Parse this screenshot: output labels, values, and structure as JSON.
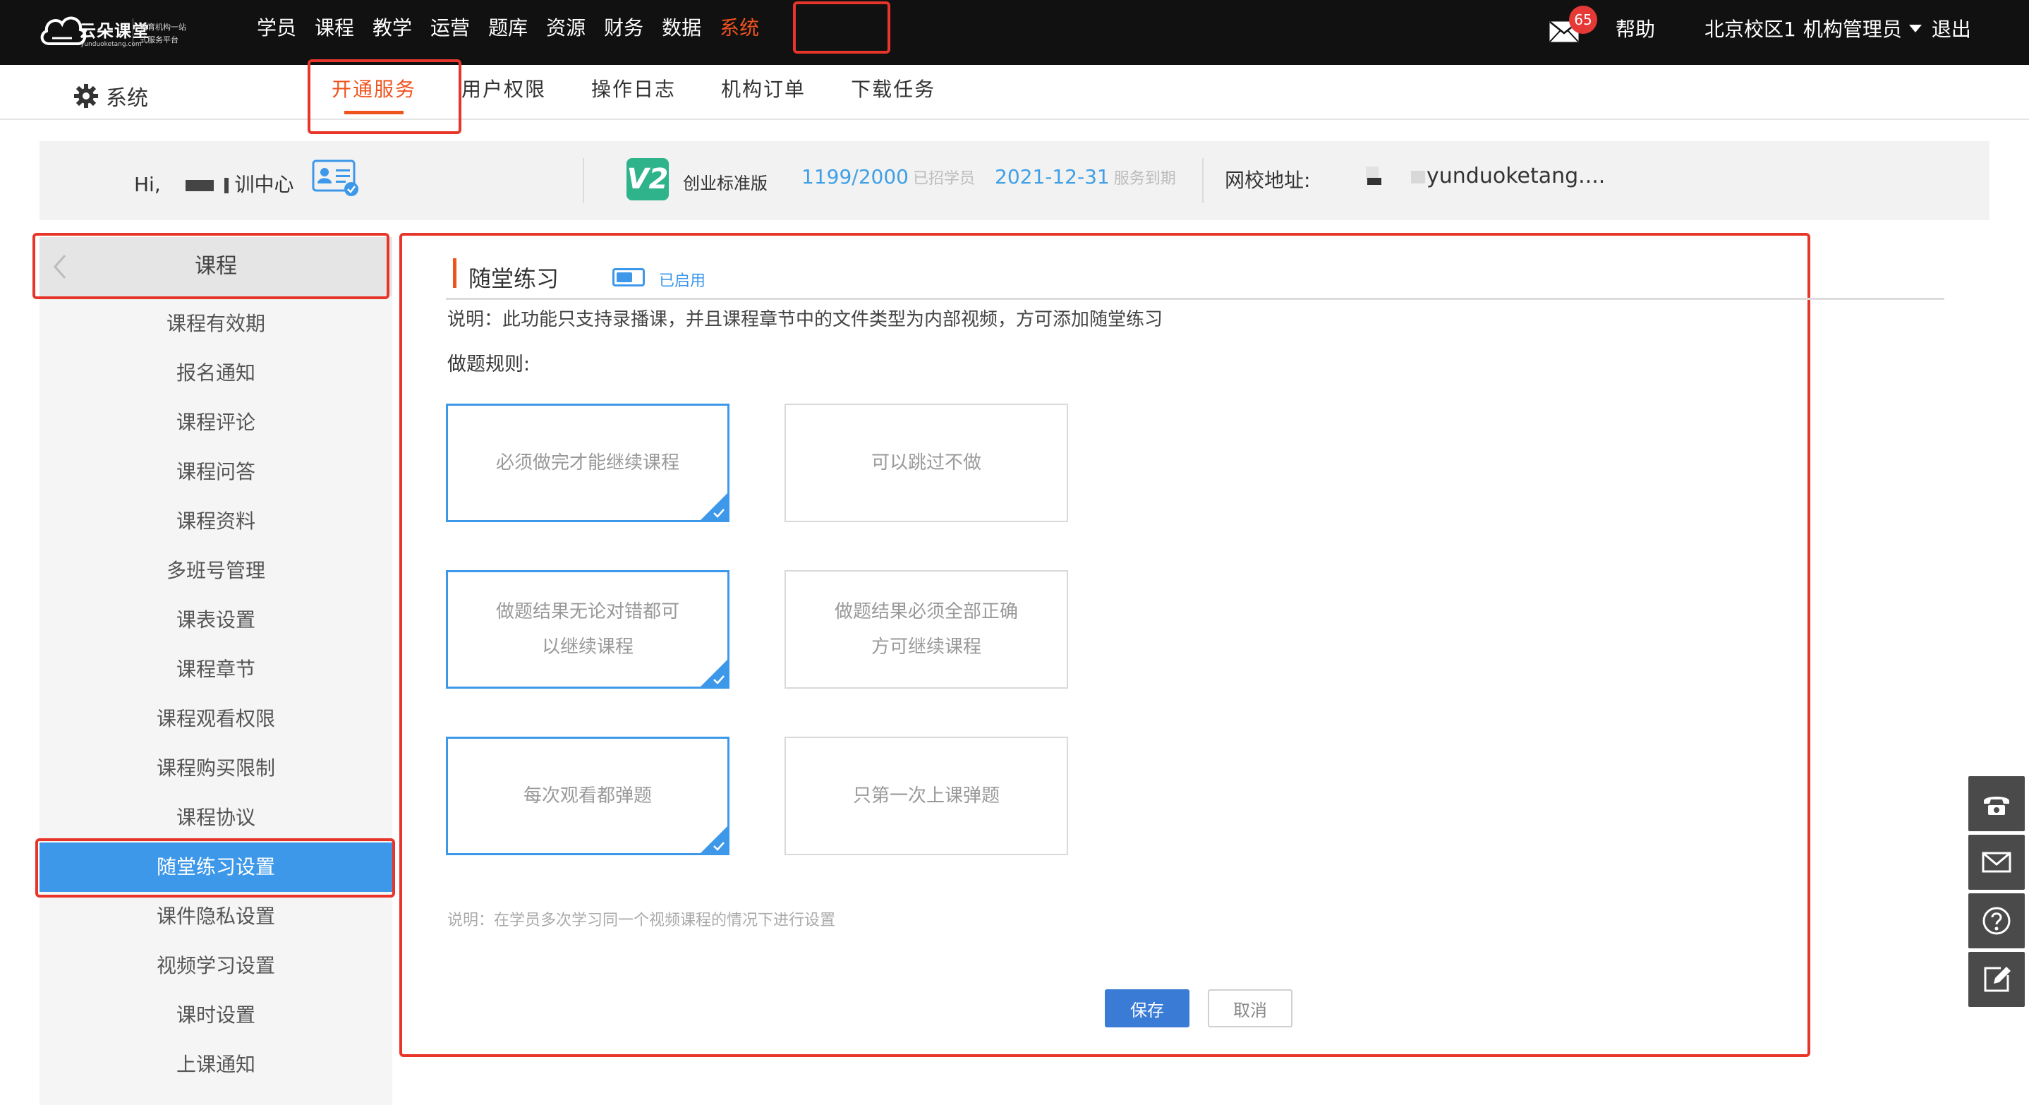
{
  "logo": {
    "name": "云朵课堂",
    "url_text": "yunduoketang.com",
    "slogan_line1": "教育机构一站",
    "slogan_line2": "式服务平台"
  },
  "top_menu": {
    "items": [
      "学员",
      "课程",
      "教学",
      "运营",
      "题库",
      "资源",
      "财务",
      "数据",
      "系统"
    ],
    "active": "系统"
  },
  "header_right": {
    "mail_badge": "65",
    "help": "帮助",
    "campus": "北京校区1",
    "role": "机构管理员",
    "logout": "退出"
  },
  "subbar": {
    "title": "系统",
    "tabs": [
      "开通服务",
      "用户权限",
      "操作日志",
      "机构订单",
      "下载任务"
    ],
    "active": "开通服务"
  },
  "infobar": {
    "greeting": "Hi,",
    "org_suffix": "训中心",
    "edition_badge": "V2",
    "edition": "创业标准版",
    "students": "1199/2000",
    "students_label": "已招学员",
    "expire_date": "2021-12-31",
    "expire_label": "服务到期",
    "school_url_label": "网校地址:",
    "school_url": "yunduoketang...."
  },
  "sidebar": {
    "header": "课程",
    "items": [
      "课程有效期",
      "报名通知",
      "课程评论",
      "课程问答",
      "课程资料",
      "多班号管理",
      "课表设置",
      "课程章节",
      "课程观看权限",
      "课程购买限制",
      "课程协议",
      "随堂练习设置",
      "课件隐私设置",
      "视频学习设置",
      "课时设置",
      "上课通知"
    ],
    "active": "随堂练习设置"
  },
  "main": {
    "section_title": "随堂练习",
    "toggle_label": "已启用",
    "toggle_on": true,
    "description": "说明：此功能只支持录播课，并且课程章节中的文件类型为内部视频，方可添加随堂练习",
    "rules_label": "做题规则:",
    "option_rows": [
      {
        "left": {
          "line1": "必须做完才能继续课程",
          "line2": "",
          "selected": true
        },
        "right": {
          "line1": "可以跳过不做",
          "line2": "",
          "selected": false
        }
      },
      {
        "left": {
          "line1": "做题结果无论对错都可",
          "line2": "以继续课程",
          "selected": true
        },
        "right": {
          "line1": "做题结果必须全部正确",
          "line2": "方可继续课程",
          "selected": false
        }
      },
      {
        "left": {
          "line1": "每次观看都弹题",
          "line2": "",
          "selected": true
        },
        "right": {
          "line1": "只第一次上课弹题",
          "line2": "",
          "selected": false
        }
      }
    ],
    "note": "说明：在学员多次学习同一个视频课程的情况下进行设置",
    "save": "保存",
    "cancel": "取消"
  },
  "float_tools": [
    "phone-icon",
    "mail-icon",
    "help-icon",
    "edit-icon"
  ],
  "colors": {
    "topbar": "#111111",
    "accent_orange": "#f0531e",
    "accent_blue": "#3d98e9",
    "save_blue": "#3a7bd5",
    "highlight_red": "#e8352a"
  }
}
